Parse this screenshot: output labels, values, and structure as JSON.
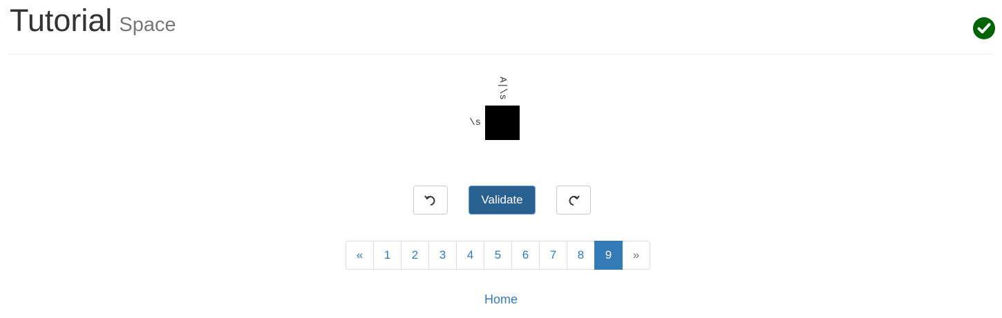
{
  "header": {
    "title": "Tutorial",
    "subtitle": "Space",
    "status_icon": "check-circle-icon",
    "status_color": "#006400"
  },
  "puzzle": {
    "column_clue": "A|\\s",
    "row_clue": "\\s",
    "cells": [
      {
        "state": "filled",
        "color": "#000000"
      }
    ]
  },
  "controls": {
    "undo_icon": "undo-icon",
    "validate_label": "Validate",
    "redo_icon": "redo-icon"
  },
  "pagination": {
    "prev_label": "«",
    "next_label": "»",
    "pages": [
      "1",
      "2",
      "3",
      "4",
      "5",
      "6",
      "7",
      "8",
      "9"
    ],
    "active_page": "9"
  },
  "footer": {
    "home_label": "Home"
  },
  "colors": {
    "primary": "#337ab7",
    "validate_bg": "#286090"
  }
}
